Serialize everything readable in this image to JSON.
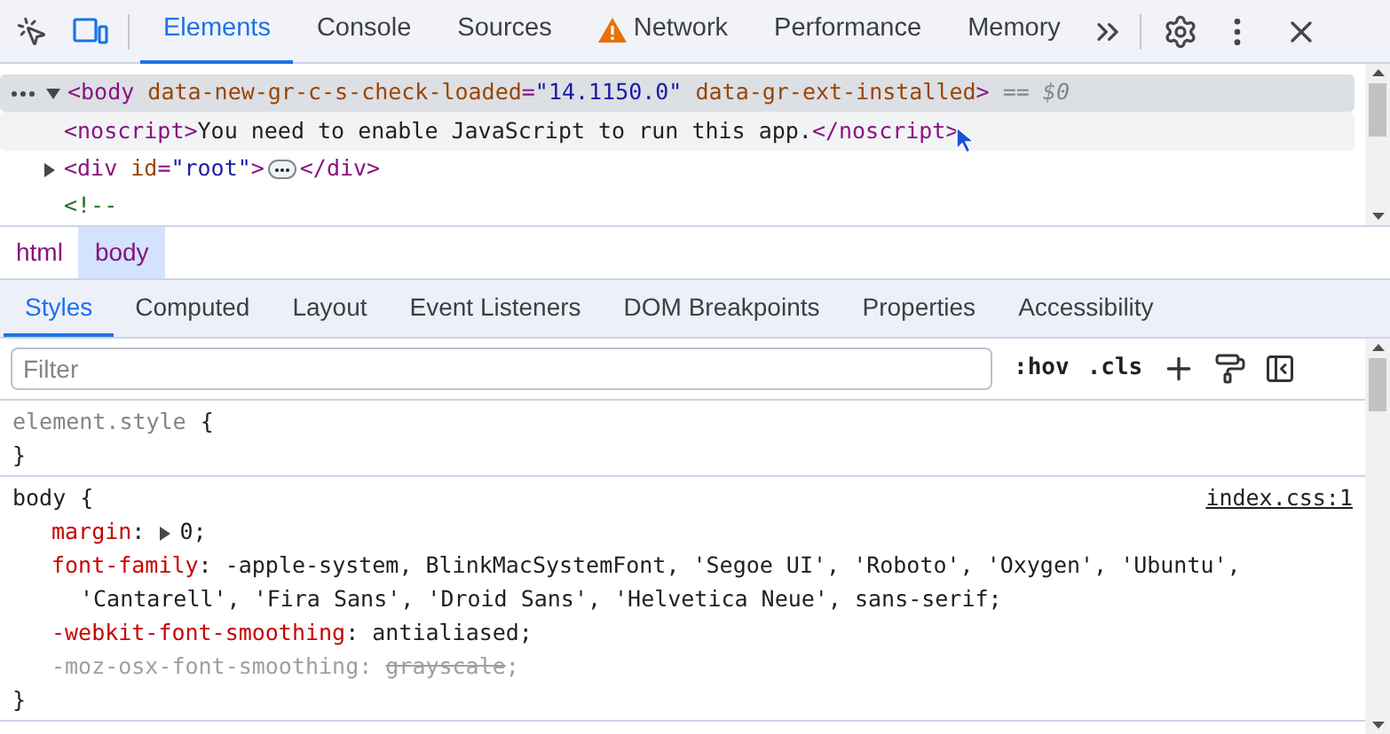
{
  "toolbar": {
    "tabs": [
      {
        "label": "Elements",
        "selected": true,
        "kind": "plain"
      },
      {
        "label": "Console",
        "selected": false,
        "kind": "plain"
      },
      {
        "label": "Sources",
        "selected": false,
        "kind": "plain"
      },
      {
        "label": "Network",
        "selected": false,
        "kind": "warning"
      },
      {
        "label": "Performance",
        "selected": false,
        "kind": "plain"
      },
      {
        "label": "Memory",
        "selected": false,
        "kind": "plain"
      }
    ]
  },
  "dom_tree": {
    "lines": [
      {
        "expanded": true,
        "selected": true,
        "hovered": false,
        "tokens": [
          {
            "kind": "tag",
            "text": "<body"
          },
          {
            "kind": "attr",
            "text": " data-new-gr-c-s-check-loaded"
          },
          {
            "kind": "tag",
            "text": "="
          },
          {
            "kind": "value",
            "text": "\"14.1150.0\""
          },
          {
            "kind": "attr",
            "text": " data-gr-ext-installed"
          },
          {
            "kind": "tag",
            "text": ">"
          },
          {
            "kind": "hint",
            "text": " == $0"
          }
        ]
      },
      {
        "selected": false,
        "hovered": true,
        "tokens": [
          {
            "kind": "tag",
            "text": "<noscript>"
          },
          {
            "kind": "text",
            "text": "You need to enable JavaScript to run this app."
          },
          {
            "kind": "tag",
            "text": "</noscript>"
          }
        ]
      },
      {
        "expanded": false,
        "selected": false,
        "hovered": false,
        "tokens": [
          {
            "kind": "tag",
            "text": "<div"
          },
          {
            "kind": "attr",
            "text": " id"
          },
          {
            "kind": "tag",
            "text": "="
          },
          {
            "kind": "value",
            "text": "\"root\""
          },
          {
            "kind": "tag",
            "text": ">"
          },
          {
            "kind": "ellipsis"
          },
          {
            "kind": "tag",
            "text": "</div>"
          }
        ]
      },
      {
        "selected": false,
        "hovered": false,
        "tokens": [
          {
            "kind": "comment",
            "text": "<!--"
          }
        ]
      }
    ]
  },
  "breadcrumbs": [
    {
      "label": "html",
      "selected": false
    },
    {
      "label": "body",
      "selected": true
    }
  ],
  "subtabs": [
    {
      "label": "Styles",
      "selected": true
    },
    {
      "label": "Computed",
      "selected": false
    },
    {
      "label": "Layout",
      "selected": false
    },
    {
      "label": "Event Listeners",
      "selected": false
    },
    {
      "label": "DOM Breakpoints",
      "selected": false
    },
    {
      "label": "Properties",
      "selected": false
    },
    {
      "label": "Accessibility",
      "selected": false
    }
  ],
  "filter": {
    "placeholder": "Filter",
    "hov": ":hov",
    "cls": ".cls"
  },
  "rules": [
    {
      "selector": "element.style",
      "inline": true,
      "open": "{",
      "close": "}"
    },
    {
      "selector": "body",
      "inline": false,
      "open": "{",
      "close": "}",
      "source": "index.css:1",
      "declarations": [
        {
          "name": "margin",
          "colon": ":",
          "value": "0;",
          "expandable": true,
          "overridden": false
        },
        {
          "name": "font-family",
          "colon": ":",
          "value": "-apple-system, BlinkMacSystemFont, 'Segoe UI', 'Roboto', 'Oxygen', 'Ubuntu', 'Cantarell', 'Fira Sans', 'Droid Sans', 'Helvetica Neue', sans-serif;",
          "overridden": false
        },
        {
          "name": "-webkit-font-smoothing",
          "colon": ":",
          "value": "antialiased;",
          "overridden": false
        },
        {
          "name": "-moz-osx-font-smoothing",
          "colon": ":",
          "value": "grayscale",
          "end": ";",
          "overridden": true
        }
      ]
    }
  ]
}
